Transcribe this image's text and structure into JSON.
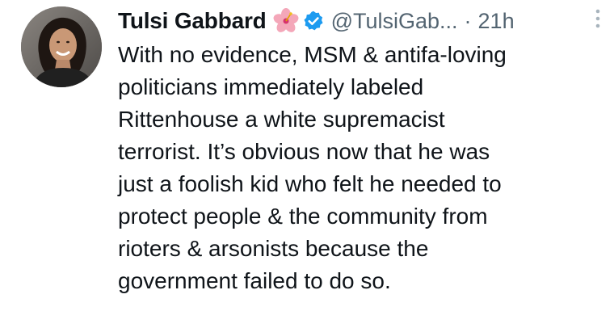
{
  "tweet": {
    "author_name": "Tulsi Gabbard",
    "author_handle": "@TulsiGab...",
    "separator": "·",
    "timestamp": "21h",
    "name_emoji_icon": "hibiscus-flower-icon",
    "verified_icon": "verified-badge-icon",
    "verified_color": "#1d9bf0",
    "more_icon": "more-options-icon",
    "text_lines": [
      "With no evidence, MSM & antifa-loving",
      "politicians immediately labeled",
      "Rittenhouse a white supremacist",
      "terrorist. It’s obvious now that he was",
      "just a foolish kid who felt he needed to",
      "protect people & the community from",
      "rioters & arsonists because the",
      "government failed to do so."
    ]
  },
  "colors": {
    "text_primary": "#0f1419",
    "text_secondary": "#536471",
    "background": "#ffffff"
  }
}
